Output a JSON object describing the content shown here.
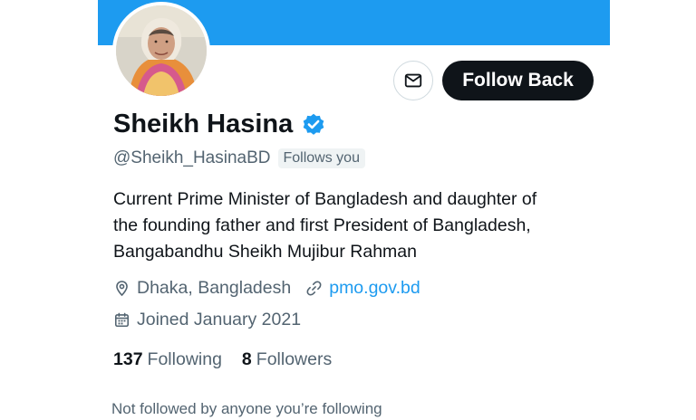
{
  "colors": {
    "banner": "#1d9bf0",
    "accent": "#1d9bf0",
    "primary_text": "#0f1419",
    "secondary_text": "#536471",
    "follow_button_bg": "#0f1419"
  },
  "header": {
    "avatar_icon": "profile-photo",
    "message_icon": "envelope-icon",
    "follow_button_label": "Follow Back"
  },
  "profile": {
    "name": "Sheikh Hasina",
    "verified_icon": "verified-badge-icon",
    "handle": "@Sheikh_HasinaBD",
    "follows_you_label": "Follows you",
    "bio_lines": [
      "Current Prime Minister of Bangladesh and daughter of",
      "the founding father and first President of Bangladesh,",
      "Bangabandhu Sheikh Mujibur Rahman"
    ],
    "location_icon": "location-pin-icon",
    "location": "Dhaka, Bangladesh",
    "link_icon": "link-icon",
    "website": "pmo.gov.bd",
    "joined_icon": "calendar-icon",
    "joined": "Joined January 2021"
  },
  "stats": {
    "following_count": "137",
    "following_label": "Following",
    "followers_count": "8",
    "followers_label": "Followers"
  },
  "footer": {
    "not_followed_text": "Not followed by anyone you’re following"
  }
}
